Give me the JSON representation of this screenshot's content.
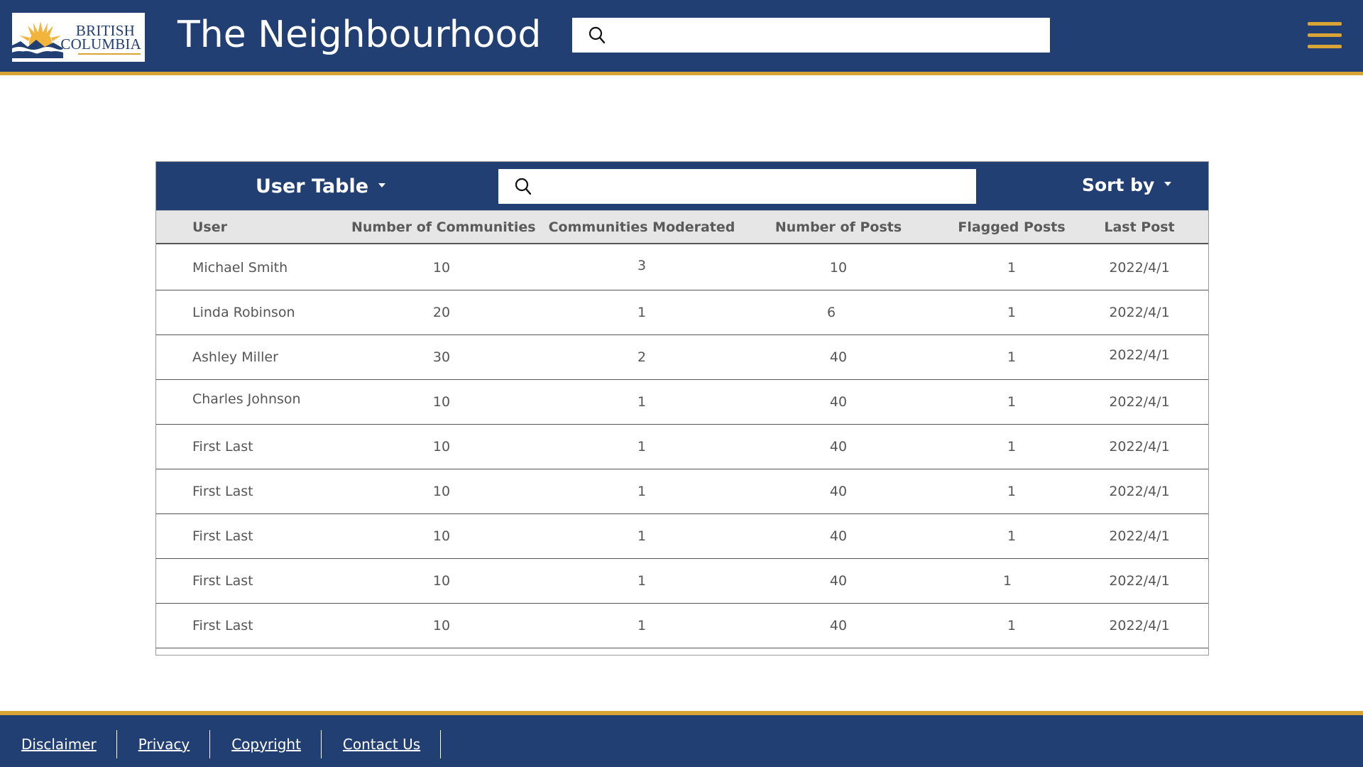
{
  "header": {
    "logo": {
      "line1": "BRITISH",
      "line2": "COLUMBIA"
    },
    "title": "The Neighbourhood",
    "search": {
      "value": "",
      "placeholder": ""
    },
    "menu_icon": "hamburger-menu-icon"
  },
  "table": {
    "selector_label": "User Table",
    "search": {
      "value": "",
      "placeholder": ""
    },
    "sort_label": "Sort by",
    "columns": [
      "User",
      "Number of Communities",
      "Communities Moderated",
      "Number of Posts",
      "Flagged Posts",
      "Last Post"
    ],
    "rows": [
      {
        "user": "Michael Smith",
        "communities": "10",
        "moderated": "3",
        "posts": "10",
        "flagged": "1",
        "last_post": "2022/4/1"
      },
      {
        "user": "Linda Robinson",
        "communities": "20",
        "moderated": "1",
        "posts": "6",
        "flagged": "1",
        "last_post": "2022/4/1"
      },
      {
        "user": "Ashley Miller",
        "communities": "30",
        "moderated": "2",
        "posts": "40",
        "flagged": "1",
        "last_post": "2022/4/1"
      },
      {
        "user": "Charles Johnson",
        "communities": "10",
        "moderated": "1",
        "posts": "40",
        "flagged": "1",
        "last_post": "2022/4/1"
      },
      {
        "user": "First Last",
        "communities": "10",
        "moderated": "1",
        "posts": "40",
        "flagged": "1",
        "last_post": "2022/4/1"
      },
      {
        "user": "First Last",
        "communities": "10",
        "moderated": "1",
        "posts": "40",
        "flagged": "1",
        "last_post": "2022/4/1"
      },
      {
        "user": "First Last",
        "communities": "10",
        "moderated": "1",
        "posts": "40",
        "flagged": "1",
        "last_post": "2022/4/1"
      },
      {
        "user": "First Last",
        "communities": "10",
        "moderated": "1",
        "posts": "40",
        "flagged": "1",
        "last_post": "2022/4/1"
      },
      {
        "user": "First Last",
        "communities": "10",
        "moderated": "1",
        "posts": "40",
        "flagged": "1",
        "last_post": "2022/4/1"
      }
    ]
  },
  "footer": {
    "links": [
      "Disclaimer",
      "Privacy",
      "Copyright",
      "Contact Us"
    ]
  },
  "colors": {
    "primary": "#223f73",
    "accent": "#d9a436",
    "header_row_bg": "#e6e6e6",
    "text": "#555555"
  }
}
